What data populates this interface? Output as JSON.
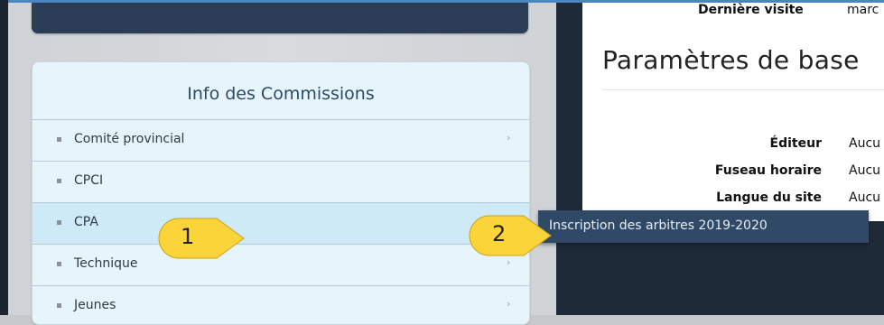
{
  "header": {
    "last_visit_label": "Dernière visite",
    "last_visit_value": "marc"
  },
  "settings": {
    "title": "Paramètres de base",
    "rows": [
      {
        "label": "Éditeur",
        "value": "Aucu"
      },
      {
        "label": "Fuseau horaire",
        "value": "Aucu"
      },
      {
        "label": "Langue du site",
        "value": "Aucu"
      }
    ]
  },
  "commissions": {
    "title": "Info des Commissions",
    "items": [
      {
        "label": "Comité provincial",
        "has_submenu": true
      },
      {
        "label": "CPCI",
        "has_submenu": false
      },
      {
        "label": "CPA",
        "has_submenu": true,
        "active": true
      },
      {
        "label": "Technique",
        "has_submenu": true
      },
      {
        "label": "Jeunes",
        "has_submenu": true
      }
    ]
  },
  "submenu": {
    "item": "Inscription des arbitres 2019-2020"
  },
  "callouts": {
    "one": "1",
    "two": "2"
  },
  "icons": {
    "chevron": "chevron-right-icon",
    "bullet": "square-bullet-icon"
  },
  "colors": {
    "accent_dark": "#2b3d57",
    "submenu_bg": "#304966",
    "callout_fill": "#fbd43a",
    "panel_bg": "#e6f4fb",
    "active_row": "#cfeaf7"
  }
}
